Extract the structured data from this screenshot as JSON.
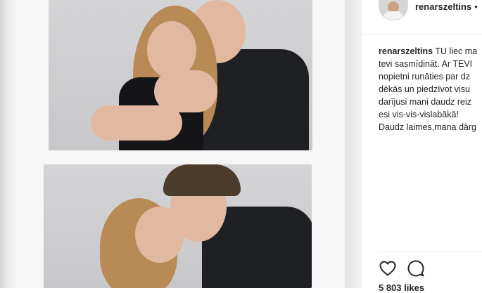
{
  "post": {
    "username": "renarszeltins",
    "header_separator": "•",
    "caption_username": "renarszeltins",
    "caption_lines": [
      "TU liec ma",
      "tevi sasmīdināt. Ar TEVI",
      "nopietni runāties par dz",
      "dēkās un piedzīvot visu",
      "darījusi mani daudz reiz",
      "esi vis-vis-vislabākā!",
      "Daudz laimes,mana dārg"
    ],
    "likes": "5 803 likes"
  },
  "icons": {
    "like": "heart-icon",
    "comment": "comment-icon"
  },
  "colors": {
    "text": "#262626",
    "border": "#efefef",
    "photo_background": "#e9e9ea"
  }
}
